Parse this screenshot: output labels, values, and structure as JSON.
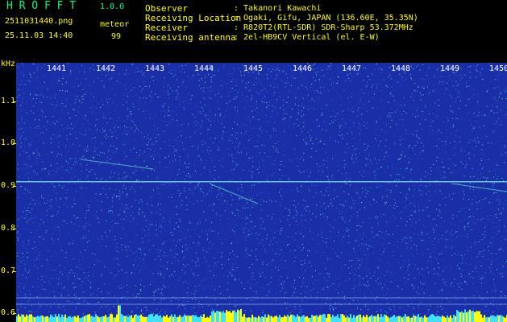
{
  "header": {
    "app_title": "H R O F F T",
    "version": "1.0.0",
    "file_name": "2511031440.png",
    "date_time": "25.11.03 14:40",
    "mode_label": "meteor",
    "count_value": "99"
  },
  "info": [
    {
      "key": "Observer",
      "value": ": Takanori Kawachi"
    },
    {
      "key": "Receiving Location",
      "value": ": Ogaki, Gifu, JAPAN (136.60E, 35.35N)"
    },
    {
      "key": "Receiver",
      "value": ": R820T2(RTL-SDR) SDR-Sharp 53.372MHz"
    },
    {
      "key": "Receiving antenna",
      "value": ": 2el-HB9CV Vertical (el. E-W)"
    }
  ],
  "chart_data": {
    "type": "heatmap",
    "ylabel": "kHz",
    "x_ticks": [
      "1441",
      "1442",
      "1443",
      "1444",
      "1445",
      "1446",
      "1447",
      "1448",
      "1449",
      "1450"
    ],
    "y_ticks": [
      "1.1",
      "1.0",
      "0.9",
      "0.8",
      "0.7",
      "0.6"
    ],
    "y_tick_values": [
      1.1,
      1.0,
      0.9,
      0.8,
      0.7,
      0.6
    ],
    "ylim": [
      0.58,
      1.19
    ],
    "carrier_khz": 0.91
  },
  "colors": {
    "background": "#000000",
    "spectrogram_base": "#1a2ea8",
    "label_yellow": "#ffff00",
    "title_green": "#00ff7f",
    "carrier_cyan": "#7fffd4"
  }
}
